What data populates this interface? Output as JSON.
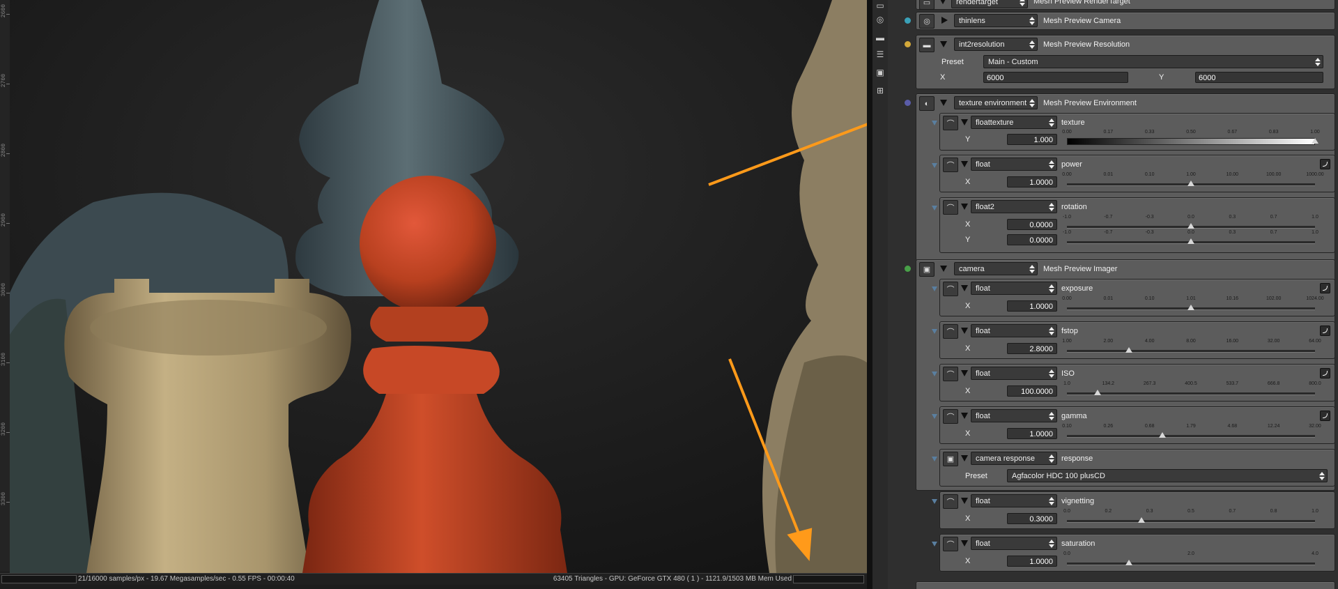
{
  "viewport": {
    "status_left": "21/16000 samples/px - 19.67 Megasamples/sec - 0.55 FPS - 00:00:40",
    "status_right": "63405 Triangles - GPU: GeForce GTX 480 ( 1 ) - 1121.9/1503 MB Mem Used",
    "ruler_labels": [
      "2600",
      "2700",
      "2800",
      "2900",
      "3000",
      "3100",
      "3200",
      "3300"
    ]
  },
  "toolbar_icons": [
    "camera-icon",
    "resolution-icon",
    "database-icon",
    "image-icon",
    "node-graph-icon"
  ],
  "nodes": {
    "rendertarget": {
      "type": "rendertarget",
      "name": "Mesh Preview RenderTarget"
    },
    "camera_thin": {
      "type": "thinlens",
      "name": "Mesh Preview Camera"
    },
    "resolution": {
      "type": "int2resolution",
      "name": "Mesh Preview Resolution",
      "preset_label": "Preset",
      "preset_value": "Main - Custom",
      "x_label": "X",
      "x_value": "6000",
      "y_label": "Y",
      "y_value": "6000"
    },
    "environment": {
      "type": "texture environment",
      "name": "Mesh Preview Environment",
      "texture": {
        "type": "floattexture",
        "name": "texture",
        "axis": "Y",
        "value": "1.000",
        "scale": [
          "0.00",
          "0.17",
          "0.33",
          "0.50",
          "0.67",
          "0.83",
          "1.00"
        ],
        "level": 1.0
      },
      "power": {
        "type": "float",
        "name": "power",
        "axis": "X",
        "value": "1.0000",
        "scale": [
          "0.00",
          "0.01",
          "0.10",
          "1.00",
          "10.00",
          "100.00",
          "1000.00"
        ],
        "level": 0.5
      },
      "rotation": {
        "type": "float2",
        "name": "rotation",
        "x_axis": "X",
        "x_value": "0.0000",
        "y_axis": "Y",
        "y_value": "0.0000",
        "scale": [
          "-1.0",
          "-0.7",
          "-0.3",
          "0.0",
          "0.3",
          "0.7",
          "1.0"
        ],
        "x_level": 0.5,
        "y_level": 0.5
      }
    },
    "imager": {
      "type": "camera",
      "name": "Mesh Preview Imager",
      "exposure": {
        "type": "float",
        "name": "exposure",
        "axis": "X",
        "value": "1.0000",
        "scale": [
          "0.00",
          "0.01",
          "0.10",
          "1.01",
          "10.16",
          "102.00",
          "1024.00"
        ],
        "level": 0.5
      },
      "fstop": {
        "type": "float",
        "name": "fstop",
        "axis": "X",
        "value": "2.8000",
        "scale": [
          "1.00",
          "2.00",
          "4.00",
          "8.00",
          "16.00",
          "32.00",
          "64.00"
        ],
        "level": 0.25
      },
      "iso": {
        "type": "float",
        "name": "ISO",
        "axis": "X",
        "value": "100.0000",
        "scale": [
          "1.0",
          "134.2",
          "267.3",
          "400.5",
          "533.7",
          "666.8",
          "800.0"
        ],
        "level": 0.124
      },
      "gamma": {
        "type": "float",
        "name": "gamma",
        "axis": "X",
        "value": "1.0000",
        "scale": [
          "0.10",
          "0.26",
          "0.68",
          "1.79",
          "4.68",
          "12.24",
          "32.00"
        ],
        "level": 0.385
      },
      "response": {
        "type": "camera response",
        "name": "response",
        "preset_label": "Preset",
        "preset_value": "Agfacolor HDC 100 plusCD"
      },
      "vignetting": {
        "type": "float",
        "name": "vignetting",
        "axis": "X",
        "value": "0.3000",
        "scale": [
          "0.0",
          "0.2",
          "0.3",
          "0.5",
          "0.7",
          "0.8",
          "1.0"
        ],
        "level": 0.3
      },
      "saturation": {
        "type": "float",
        "name": "saturation",
        "axis": "X",
        "value": "1.0000",
        "scale": [
          "0.0",
          "2.0",
          "4.0"
        ],
        "level": 0.25
      }
    }
  },
  "colors": {
    "annotation_arrow": "#ff9a1a",
    "panel_card": "#5c5c5c",
    "viewport_bg": "#1d1d1d"
  }
}
